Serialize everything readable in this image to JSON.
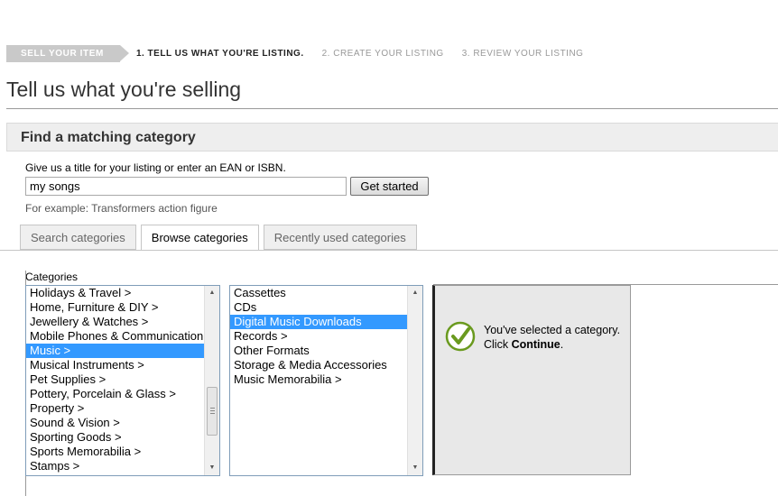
{
  "progress": {
    "current_section": "SELL YOUR ITEM",
    "steps": [
      "1. TELL US WHAT YOU'RE LISTING.",
      "2. CREATE YOUR LISTING",
      "3. REVIEW YOUR LISTING"
    ]
  },
  "page_title": "Tell us what you're selling",
  "panel_title": "Find a matching category",
  "search": {
    "prompt": "Give us a title for your listing or enter an EAN or ISBN.",
    "value": "my songs",
    "button_label": "Get started",
    "example": "For example: Transformers action figure"
  },
  "tabs": [
    {
      "label": "Search categories",
      "active": false
    },
    {
      "label": "Browse categories",
      "active": true
    },
    {
      "label": "Recently used categories",
      "active": false
    }
  ],
  "categories_label": "Categories",
  "top_level_categories": [
    "Holidays & Travel >",
    "Home, Furniture & DIY >",
    "Jewellery & Watches >",
    "Mobile Phones & Communication",
    "Music >",
    "Musical Instruments >",
    "Pet Supplies >",
    "Pottery, Porcelain & Glass >",
    "Property >",
    "Sound & Vision >",
    "Sporting Goods >",
    "Sports Memorabilia >",
    "Stamps >"
  ],
  "top_level_selected": 4,
  "sub_categories": [
    "Cassettes",
    "CDs",
    "Digital Music Downloads",
    "Records >",
    "Other Formats",
    "Storage & Media Accessories",
    "Music Memorabilia >"
  ],
  "sub_selected": 2,
  "selection": {
    "message_prefix": "You've selected a category. Click ",
    "message_action": "Continue",
    "message_suffix": "."
  },
  "colors": {
    "selection_highlight": "#3399ff",
    "check_icon": "#6a9a1f",
    "panel_header_bg": "#eeeeee"
  }
}
